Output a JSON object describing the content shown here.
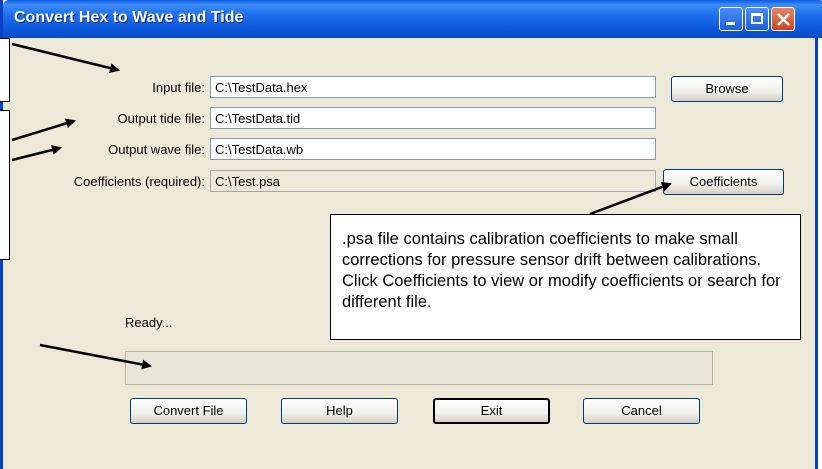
{
  "window": {
    "title": "Convert Hex to Wave and Tide"
  },
  "form": {
    "input_label": "Input file:",
    "input_value": "C:\\TestData.hex",
    "output_tide_label": "Output tide file:",
    "output_tide_value": "C:\\TestData.tid",
    "output_wave_label": "Output wave file:",
    "output_wave_value": "C:\\TestData.wb",
    "coefficients_label": "Coefficients (required):",
    "coefficients_value": "C:\\Test.psa"
  },
  "buttons": {
    "browse": "Browse",
    "coefficients": "Coefficients",
    "convert": "Convert File",
    "help": "Help",
    "exit": "Exit",
    "cancel": "Cancel"
  },
  "status": {
    "text": "Ready..."
  },
  "callout": {
    "text": ".psa file contains calibration coefficients to make small corrections for pressure sensor drift between calibrations. Click Coefficients to view or modify coefficients or search for different file."
  }
}
